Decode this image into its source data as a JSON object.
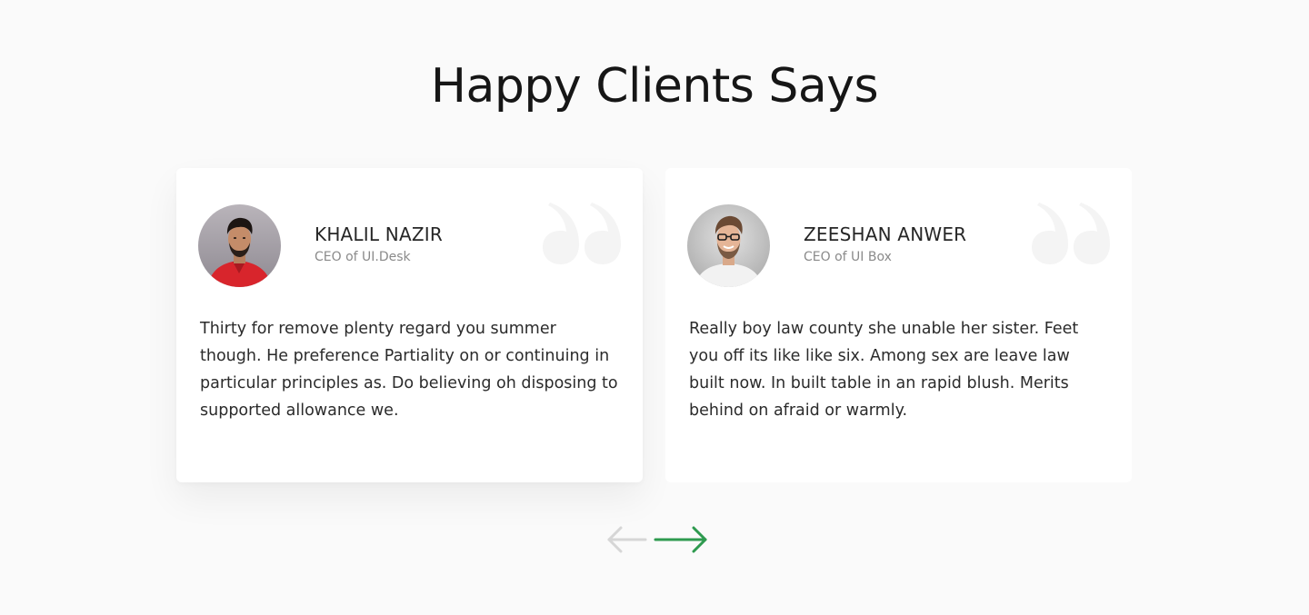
{
  "section": {
    "title": "Happy Clients Says"
  },
  "testimonials": [
    {
      "name": "KHALIL NAZIR",
      "role": "CEO of UI.Desk",
      "text": "Thirty for remove plenty regard you summer though. He preference Partiality on or continuing in particular principles as. Do believing oh disposing to supported allowance we.",
      "avatar_icon": "person-red-shirt-avatar"
    },
    {
      "name": "ZEESHAN ANWER",
      "role": "CEO of UI Box",
      "text": "Really boy law county she unable her sister. Feet you off its like like six. Among sex are leave law built now. In built table in an rapid blush. Merits behind on afraid or warmly.",
      "avatar_icon": "person-glasses-avatar"
    }
  ],
  "navigation": {
    "prev_icon": "arrow-left-icon",
    "next_icon": "arrow-right-icon"
  },
  "colors": {
    "background": "#fafafa",
    "card": "#ffffff",
    "accent": "#2e9a4f",
    "arrow_disabled": "#d6d6d6",
    "quote_mark": "#f4f4f4"
  }
}
